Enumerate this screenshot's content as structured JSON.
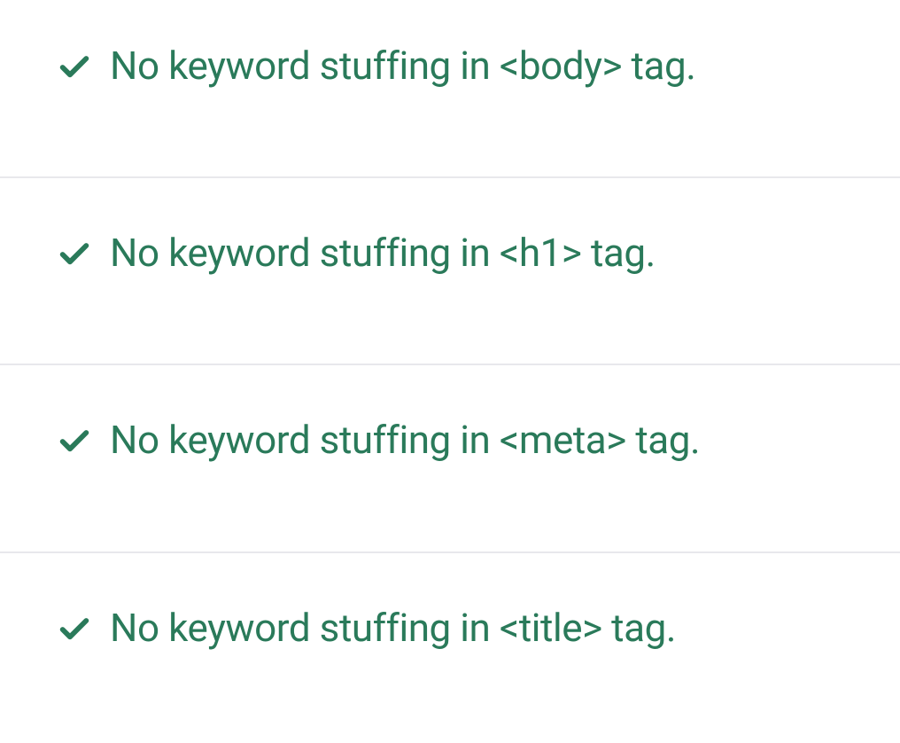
{
  "checks": [
    {
      "label": "No keyword stuffing in <body> tag."
    },
    {
      "label": "No keyword stuffing in <h1> tag."
    },
    {
      "label": "No keyword stuffing in <meta> tag."
    },
    {
      "label": "No keyword stuffing in <title> tag."
    }
  ],
  "colors": {
    "success": "#2a7a5a",
    "divider": "#e8e8ec"
  }
}
